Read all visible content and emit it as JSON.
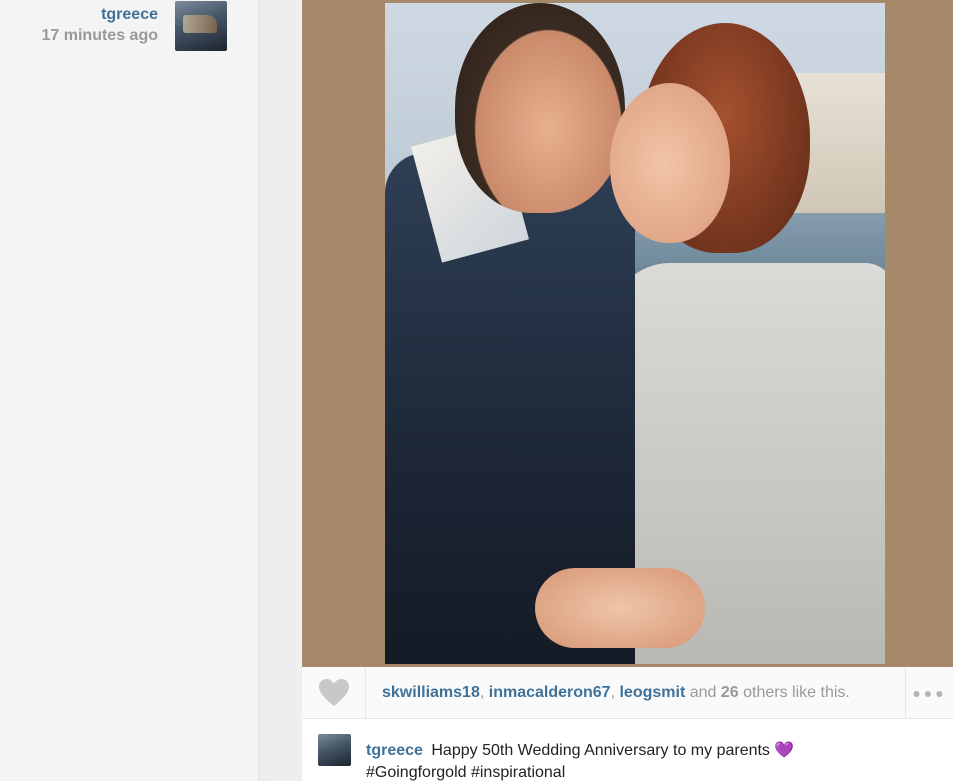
{
  "author": {
    "username": "tgreece",
    "timestamp": "17 minutes ago"
  },
  "likes": {
    "likers": [
      "skwilliams18",
      "inmacalderon67",
      "leogsmit"
    ],
    "and_text": "and",
    "others_count": "26",
    "others_text": "others like this.",
    "sep": ","
  },
  "caption": {
    "username": "tgreece",
    "text": "Happy 50th Wedding Anniversary to my parents",
    "emoji": "💜",
    "hashtags": "#Goingforgold #inspirational"
  },
  "icons": {
    "like": "heart-icon",
    "more": "more-options-icon"
  },
  "colors": {
    "link": "#3f729b",
    "muted": "#999999",
    "frame": "#a68968"
  }
}
